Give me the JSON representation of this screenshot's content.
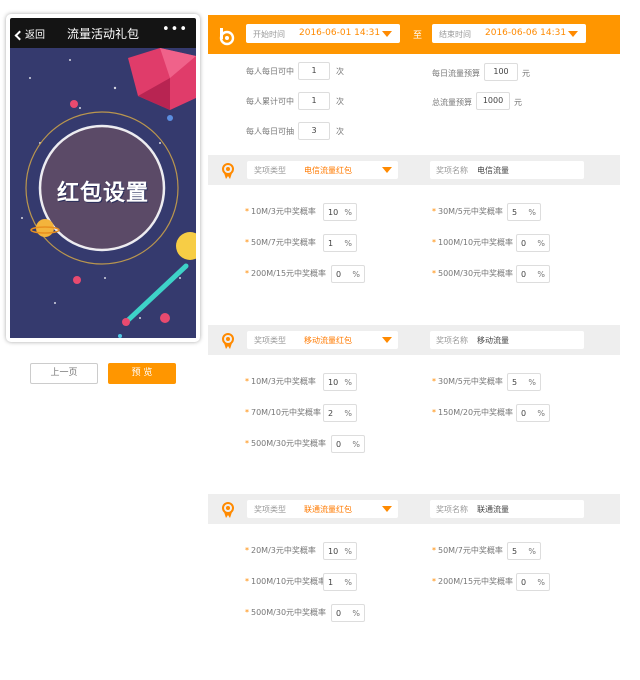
{
  "phone": {
    "back_label": "返回",
    "title": "流量活动礼包",
    "more_label": "•••",
    "hero_text": "红包设置"
  },
  "nav": {
    "prev_label": "上一页",
    "preview_label": "预 览"
  },
  "time": {
    "start_label": "开始时间",
    "start_value": "2016-06-01 14:31",
    "to_label": "至",
    "end_label": "结束时间",
    "end_value": "2016-06-06 14:31"
  },
  "limits": {
    "daily_count_label": "每人每日可中",
    "daily_count_value": "1",
    "total_count_label": "每人累计可中",
    "total_count_value": "1",
    "daily_draw_label": "每人每日可抽",
    "daily_draw_value": "3",
    "count_unit": "次",
    "daily_budget_label": "每日流量预算",
    "daily_budget_value": "100",
    "total_budget_label": "总流量预算",
    "total_budget_value": "1000",
    "budget_unit": "元"
  },
  "prize_sections": [
    {
      "type_label": "奖项类型",
      "type_value": "电信流量红包",
      "name_label": "奖项名称",
      "name_value": "电信流量",
      "percent_unit": "%",
      "left": [
        {
          "label": "10M/3元中奖概率",
          "value": "10"
        },
        {
          "label": "50M/7元中奖概率",
          "value": "1"
        },
        {
          "label": "200M/15元中奖概率",
          "value": "0"
        }
      ],
      "right": [
        {
          "label": "30M/5元中奖概率",
          "value": "5"
        },
        {
          "label": "100M/10元中奖概率",
          "value": "0"
        },
        {
          "label": "500M/30元中奖概率",
          "value": "0"
        }
      ]
    },
    {
      "type_label": "奖项类型",
      "type_value": "移动流量红包",
      "name_label": "奖项名称",
      "name_value": "移动流量",
      "percent_unit": "%",
      "left": [
        {
          "label": "10M/3元中奖概率",
          "value": "10"
        },
        {
          "label": "70M/10元中奖概率",
          "value": "2"
        },
        {
          "label": "500M/30元中奖概率",
          "value": "0"
        }
      ],
      "right": [
        {
          "label": "30M/5元中奖概率",
          "value": "5"
        },
        {
          "label": "150M/20元中奖概率",
          "value": "0"
        }
      ]
    },
    {
      "type_label": "奖项类型",
      "type_value": "联通流量红包",
      "name_label": "奖项名称",
      "name_value": "联通流量",
      "percent_unit": "%",
      "left": [
        {
          "label": "20M/3元中奖概率",
          "value": "10"
        },
        {
          "label": "100M/10元中奖概率",
          "value": "1"
        },
        {
          "label": "500M/30元中奖概率",
          "value": "0"
        }
      ],
      "right": [
        {
          "label": "50M/7元中奖概率",
          "value": "5"
        },
        {
          "label": "200M/15元中奖概率",
          "value": "0"
        }
      ]
    }
  ],
  "colors": {
    "accent": "#ff9600",
    "phone_bg": "#353a6e",
    "section_bg": "#eeeeee"
  }
}
